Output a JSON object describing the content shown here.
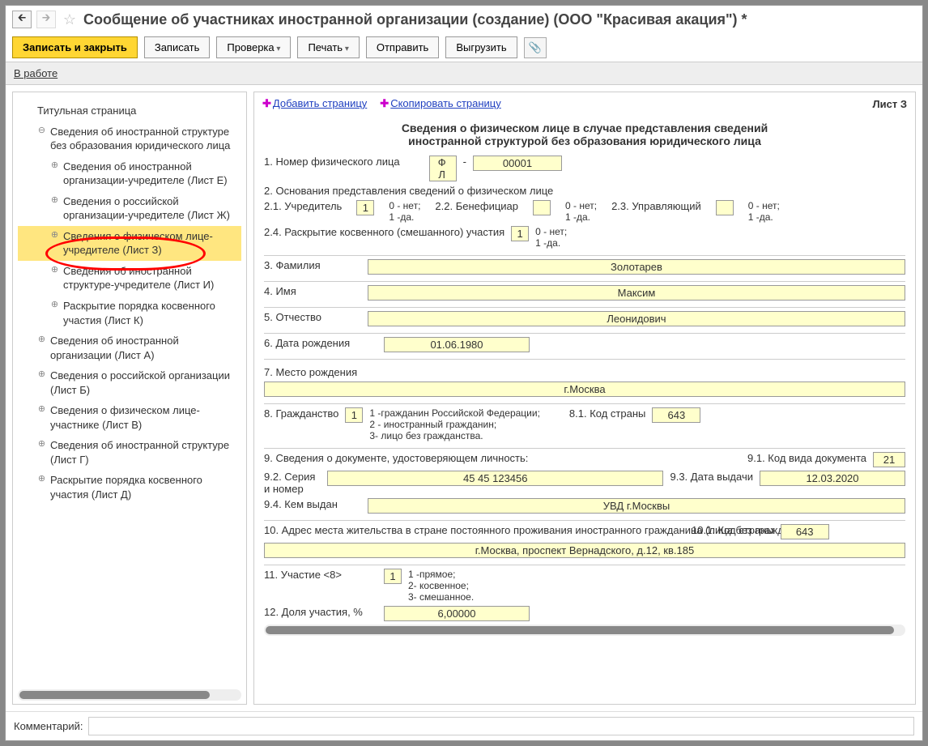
{
  "title": "Сообщение об участниках иностранной организации (создание) (ООО \"Красивая акация\") *",
  "toolbar": {
    "save_close": "Записать и закрыть",
    "save": "Записать",
    "check": "Проверка",
    "print": "Печать",
    "send": "Отправить",
    "export": "Выгрузить"
  },
  "status": "В работе",
  "tree": {
    "t0": "Титульная страница",
    "t1": "Сведения об иностранной структуре без образования юридического лица",
    "t1a": "Сведения об иностранной организации-учредителе (Лист Е)",
    "t1b": "Сведения о российской организации-учредителе (Лист Ж)",
    "t1c": "Сведения о физическом лице-учредителе (Лист З)",
    "t1d": "Сведения об иностранной структуре-учредителе (Лист И)",
    "t1e": "Раскрытие порядка косвенного участия (Лист К)",
    "t2": "Сведения об иностранной организации (Лист А)",
    "t3": "Сведения о российской организации (Лист Б)",
    "t4": "Сведения о физическом лице-участнике (Лист В)",
    "t5": "Сведения об иностранной структуре (Лист Г)",
    "t6": "Раскрытие порядка косвенного участия (Лист Д)"
  },
  "actions": {
    "add": "Добавить страницу",
    "copy": "Скопировать страницу"
  },
  "sheet": "Лист З",
  "form": {
    "h1": "Сведения о физическом лице в случае представления сведений",
    "h2": "иностранной структурой без образования юридического лица",
    "l1": "1. Номер физического лица",
    "fl_prefix": "Ф Л",
    "fl_num": "00001",
    "l2": "2. Основания представления сведений о физическом лице",
    "l21": "2.1. Учредитель",
    "v21": "1",
    "l22": "2.2. Бенефициар",
    "v22": "",
    "l23": "2.3. Управляющий",
    "v23": "",
    "hint01": "0 - нет;",
    "hint1": "1 -да.",
    "l24": "2.4. Раскрытие косвенного (смешанного) участия",
    "v24": "1",
    "l3": "3. Фамилия",
    "v3": "Золотарев",
    "l4": "4. Имя",
    "v4": "Максим",
    "l5": "5. Отчество",
    "v5": "Леонидович",
    "l6": "6. Дата рождения",
    "v6": "01.06.1980",
    "l7": "7. Место рождения",
    "v7": "г.Москва",
    "l8": "8. Гражданство",
    "v8": "1",
    "l8h": "1 -гражданин Российской Федерации;\n2 - иностранный гражданин;\n3- лицо без гражданства.",
    "l81": "8.1. Код страны",
    "v81": "643",
    "l9": "9. Сведения о документе, удостоверяющем личность:",
    "l91": "9.1. Код вида документа",
    "v91": "21",
    "l92": "9.2. Серия и номер",
    "v92": "45 45 123456",
    "l93": "9.3. Дата выдачи",
    "v93": "12.03.2020",
    "l94": "9.4. Кем выдан",
    "v94": "УВД г.Москвы",
    "l10": "10. Адрес места жительства в стране постоянного проживания иностранного гражданина (лица без гражданства)",
    "l101": "10.1. Код страны",
    "v101": "643",
    "v10": "г.Москва, проспект Вернадского, д.12, кв.185",
    "l11": "11. Участие <8>",
    "v11": "1",
    "l11h": "1 -прямое;\n2- косвенное;\n3- смешанное.",
    "l12": "12. Доля участия, %",
    "v12": "6,00000"
  },
  "footer": {
    "comment": "Комментарий:"
  }
}
